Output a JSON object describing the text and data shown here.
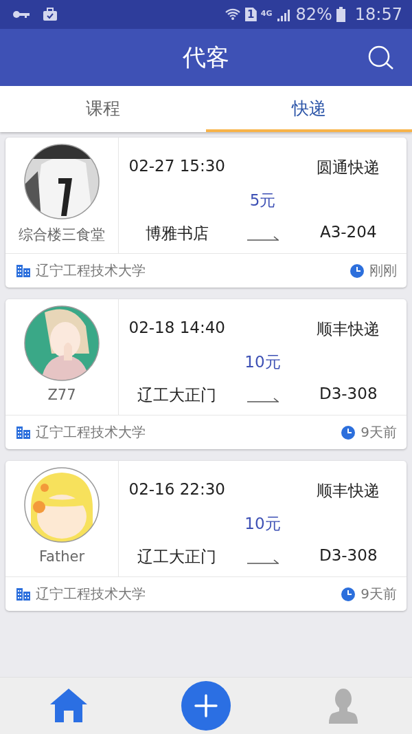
{
  "status_bar": {
    "sim": "1",
    "network": "4G",
    "battery": "82%",
    "time": "18:57"
  },
  "app_bar": {
    "title": "代客"
  },
  "tabs": [
    {
      "label": "课程",
      "selected": false
    },
    {
      "label": "快递",
      "selected": true
    }
  ],
  "orders": [
    {
      "name": "综合楼三食堂",
      "datetime": "02-27 15:30",
      "courier": "圆通快递",
      "price": "5元",
      "from": "博雅书店",
      "to": "A3-204",
      "school": "辽宁工程技术大学",
      "posted": "刚刚"
    },
    {
      "name": "Z77",
      "datetime": "02-18 14:40",
      "courier": "顺丰快递",
      "price": "10元",
      "from": "辽工大正门",
      "to": "D3-308",
      "school": "辽宁工程技术大学",
      "posted": "9天前"
    },
    {
      "name": "Father",
      "datetime": "02-16 22:30",
      "courier": "顺丰快递",
      "price": "10元",
      "from": "辽工大正门",
      "to": "D3-308",
      "school": "辽宁工程技术大学",
      "posted": "9天前"
    }
  ],
  "bottom_nav": [
    {
      "kind": "home",
      "selected": true
    },
    {
      "kind": "add",
      "selected": false
    },
    {
      "kind": "profile",
      "selected": false
    }
  ]
}
